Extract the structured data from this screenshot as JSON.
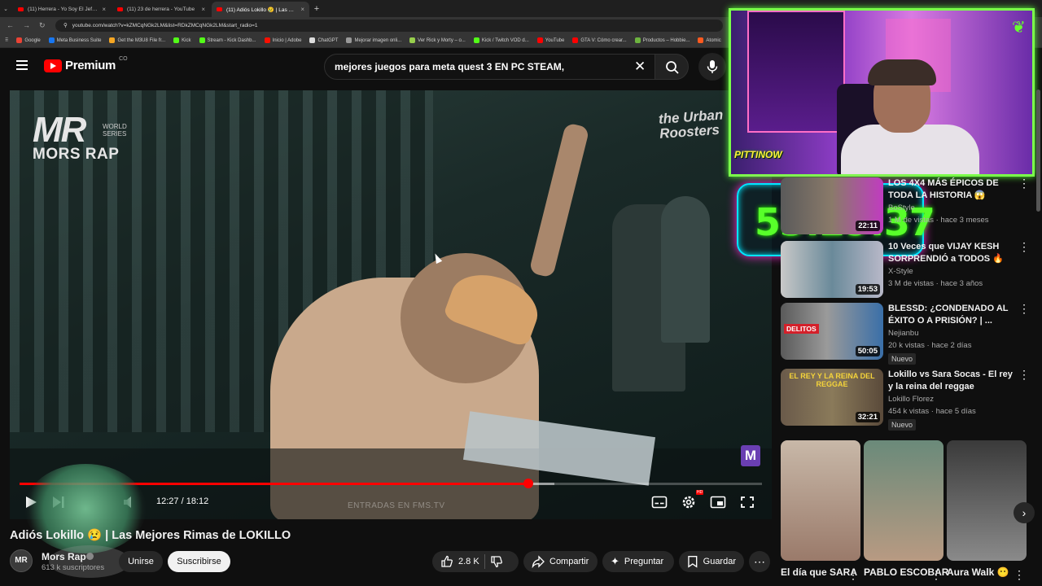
{
  "browser": {
    "tabs": [
      {
        "title": "(11) Herrera - Yo Soy El Jefe (Vi"
      },
      {
        "title": "(11) 23 de herrera - YouTube"
      },
      {
        "title": "(11) Adiós Lokillo 😢 | Las Mej"
      }
    ],
    "url": "youtube.com/watch?v=kZMCqNGk2LM&list=RDkZMCqNGk2LM&start_radio=1",
    "bookmarks": [
      "Google",
      "Meta Business Suite",
      "Get the M3U8 File fr...",
      "Kick",
      "Stream - Kick Dashb...",
      "Inicio | Adobe",
      "ChatGPT",
      "Mejorar imagen onli...",
      "Ver Rick y Morty – o...",
      "Kick / Twitch VOD d...",
      "YouTube",
      "GTA V: Cómo crear...",
      "Productos – Hobbie...",
      "Atomic"
    ]
  },
  "header": {
    "logo_word": "Premium",
    "country": "CO",
    "search_value": "mejores juegos para meta quest 3  EN PC STEAM,"
  },
  "video": {
    "overlay_logo_main": "MR",
    "overlay_logo_sub": "WORLD SERIES",
    "overlay_logo_name": "MORS RAP",
    "overlay_urban": "the Urban Roosters",
    "watermark": "M",
    "entrada_text": "ENTRADAS EN FMS.TV",
    "time": "12:27 / 18:12",
    "progress": 0.685,
    "buffered": 0.72,
    "hd_badge": "HD"
  },
  "title": "Adiós Lokillo 😢 | Las Mejores Rimas de LOKILLO",
  "channel": {
    "avatar": "MR",
    "name": "Mors Rap",
    "subs": "613 k suscriptores",
    "join": "Unirse",
    "subscribe": "Suscribirse"
  },
  "actions": {
    "likes": "2.8 K",
    "share": "Compartir",
    "ask": "Preguntar",
    "save": "Guardar"
  },
  "stream": {
    "cam_brand": "PITTINOW",
    "timer": "53:29:37"
  },
  "recs": [
    {
      "title": "LOS 4X4 MÁS ÉPICOS DE TODA LA HISTORIA 😱",
      "channel": "BoStyle",
      "meta": "1 M de vistas · hace 3 meses",
      "duration": "22:11",
      "badge": ""
    },
    {
      "title": "10 Veces que VIJAY KESH SORPRENDIÓ a TODOS 🔥",
      "channel": "X-Style",
      "meta": "3 M de vistas · hace 3 años",
      "duration": "19:53",
      "badge": ""
    },
    {
      "title": "BLESSD: ¿CONDENADO AL ÉXITO O A PRISIÓN? | ...",
      "channel": "Nejianbu",
      "meta": "20 k vistas · hace 2 días",
      "duration": "50:05",
      "badge": "Nuevo",
      "thumb_text": "DELITOS"
    },
    {
      "title": "Lokillo vs Sara Socas - El rey y la reina del reggae",
      "channel": "Lokillo Florez",
      "meta": "454 k vistas · hace 5 días",
      "duration": "32:21",
      "badge": "Nuevo",
      "thumb_text": "EL REY Y LA REINA DEL REGGAE"
    }
  ],
  "shorts": [
    {
      "title": "El día que SARA"
    },
    {
      "title": "PABLO ESCOBAR"
    },
    {
      "title": "Aura Walk 😶"
    }
  ],
  "colors": {
    "accent": "#ff0000",
    "timer_green": "#58ff2a",
    "cam_border": "#7bff4a"
  }
}
